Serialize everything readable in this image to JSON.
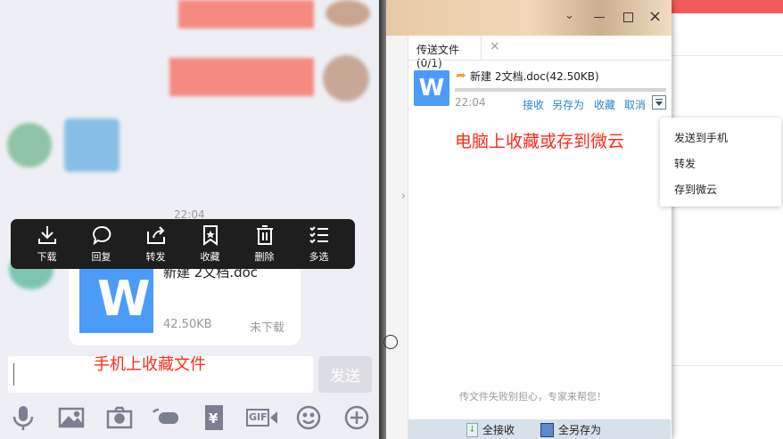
{
  "phone": {
    "timestamp": "22:04",
    "menu": [
      {
        "icon": "download-icon",
        "label": "下载"
      },
      {
        "icon": "reply-icon",
        "label": "回复"
      },
      {
        "icon": "forward-icon",
        "label": "转发"
      },
      {
        "icon": "bookmark-icon",
        "label": "收藏"
      },
      {
        "icon": "trash-icon",
        "label": "删除"
      },
      {
        "icon": "multiselect-icon",
        "label": "多选"
      }
    ],
    "file": {
      "name": "新建 2文档.doc",
      "size": "42.50KB",
      "status": "未下载",
      "icon_letter": "W"
    },
    "annotation": "手机上收藏文件",
    "send_label": "发送",
    "toolbar": [
      "microphone-icon",
      "image-icon",
      "camera-icon",
      "poke-icon",
      "red-packet-icon",
      "gif-icon",
      "emoji-icon",
      "plus-icon"
    ],
    "gif_label": "GIF",
    "yen": "¥"
  },
  "pc": {
    "tab_label": "传送文件(0/1)",
    "file": {
      "name": "新建 2文档.doc(42.50KB)",
      "time": "22:04",
      "icon_letter": "W",
      "progress": 0
    },
    "actions": [
      "接收",
      "另存为",
      "收藏",
      "取消"
    ],
    "annotation": "电脑上收藏或存到微云",
    "dropdown": [
      "发送到手机",
      "转发",
      "存到微云"
    ],
    "help_text": "传文件失败别担心，专家来帮您！",
    "bottom": {
      "receive_all": "全接收",
      "save_all": "全另存为"
    }
  },
  "colors": {
    "accent": "#2a83d8",
    "annotation": "#ff2a1a",
    "word_blue": "#4c9cf7"
  }
}
